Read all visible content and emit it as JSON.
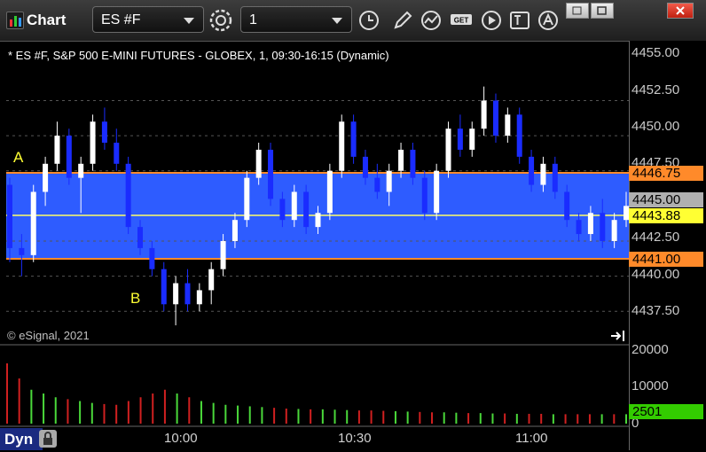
{
  "window": {
    "title": "Chart",
    "symbol": "ES #F",
    "interval": "1",
    "icons": [
      "alarm-clock-icon",
      "pencil-icon",
      "chart-line-icon",
      "get-icon",
      "play-icon",
      "text-icon",
      "alert-icon"
    ],
    "window_buttons": [
      "restore-icon",
      "maximize-icon",
      "close-icon"
    ]
  },
  "chart_title": "* ES #F, S&P 500 E-MINI FUTURES - GLOBEX, 1, 09:30-16:15 (Dynamic)",
  "copyright": "© eSignal, 2021",
  "price_axis": [
    "4455.00",
    "4452.50",
    "4450.00",
    "4447.50",
    "4445.00",
    "4442.50",
    "4440.00",
    "4437.50"
  ],
  "price_tags": {
    "upper": "4446.75",
    "last": "4445.00",
    "mid": "4443.88",
    "lower": "4441.00"
  },
  "volume_axis": [
    "20000",
    "10000",
    "0"
  ],
  "volume_tag": "2501",
  "time_axis": [
    "10:00",
    "10:30",
    "11:00"
  ],
  "annotations": {
    "a": "A",
    "b": "B"
  },
  "dyn_label": "Dyn",
  "colors": {
    "band_fill": "#2e5cff",
    "band_border": "#ff8a2a",
    "mid_line": "#ffff66",
    "up_candle": "#ffffff",
    "down_candle": "#1a2cff",
    "volume_up": "#4ad83a",
    "volume_down": "#d02020",
    "price_tag_orange": "#ff8a2a",
    "price_tag_grey": "#b0b0b0",
    "price_tag_yellow": "#ffff33",
    "volume_tag_green": "#33cc00"
  },
  "chart_data": {
    "type": "candlestick",
    "ylim": [
      4436,
      4456
    ],
    "reference_levels": {
      "upper": 4446.75,
      "mid": 4443.88,
      "lower": 4441.0
    },
    "candles_ohlc": [
      [
        4446.5,
        4447.0,
        4441.0,
        4442.0
      ],
      [
        4442.0,
        4443.0,
        4440.0,
        4441.5
      ],
      [
        4441.5,
        4446.5,
        4441.0,
        4446.0
      ],
      [
        4446.0,
        4448.5,
        4445.0,
        4448.0
      ],
      [
        4448.0,
        4451.0,
        4447.5,
        4450.0
      ],
      [
        4450.0,
        4450.5,
        4446.5,
        4447.0
      ],
      [
        4447.0,
        4448.5,
        4444.5,
        4448.0
      ],
      [
        4448.0,
        4451.5,
        4447.5,
        4451.0
      ],
      [
        4451.0,
        4452.0,
        4449.0,
        4449.5
      ],
      [
        4449.5,
        4450.5,
        4447.5,
        4448.0
      ],
      [
        4448.0,
        4448.5,
        4443.0,
        4443.5
      ],
      [
        4443.5,
        4444.0,
        4441.5,
        4442.0
      ],
      [
        4442.0,
        4442.5,
        4440.0,
        4440.5
      ],
      [
        4440.5,
        4441.0,
        4437.5,
        4438.0
      ],
      [
        4438.0,
        4440.0,
        4436.5,
        4439.5
      ],
      [
        4439.5,
        4440.5,
        4437.5,
        4438.0
      ],
      [
        4438.0,
        4439.5,
        4437.5,
        4439.0
      ],
      [
        4439.0,
        4441.0,
        4438.0,
        4440.5
      ],
      [
        4440.5,
        4443.0,
        4440.0,
        4442.5
      ],
      [
        4442.5,
        4444.5,
        4442.0,
        4444.0
      ],
      [
        4444.0,
        4447.5,
        4443.5,
        4447.0
      ],
      [
        4447.0,
        4449.5,
        4446.5,
        4449.0
      ],
      [
        4449.0,
        4449.5,
        4445.0,
        4445.5
      ],
      [
        4445.5,
        4446.0,
        4443.5,
        4444.0
      ],
      [
        4444.0,
        4446.5,
        4443.5,
        4446.0
      ],
      [
        4446.0,
        4446.5,
        4443.0,
        4443.5
      ],
      [
        4443.5,
        4445.0,
        4443.0,
        4444.5
      ],
      [
        4444.5,
        4448.0,
        4444.0,
        4447.5
      ],
      [
        4447.5,
        4451.5,
        4447.0,
        4451.0
      ],
      [
        4451.0,
        4451.5,
        4448.0,
        4448.5
      ],
      [
        4448.5,
        4449.0,
        4446.5,
        4447.0
      ],
      [
        4447.0,
        4448.0,
        4445.5,
        4446.0
      ],
      [
        4446.0,
        4448.0,
        4445.0,
        4447.5
      ],
      [
        4447.5,
        4449.5,
        4447.0,
        4449.0
      ],
      [
        4449.0,
        4449.5,
        4446.5,
        4447.0
      ],
      [
        4447.0,
        4447.5,
        4444.0,
        4444.5
      ],
      [
        4444.5,
        4448.0,
        4444.0,
        4447.5
      ],
      [
        4447.5,
        4451.0,
        4447.0,
        4450.5
      ],
      [
        4450.5,
        4451.5,
        4448.5,
        4449.0
      ],
      [
        4449.0,
        4451.0,
        4448.5,
        4450.5
      ],
      [
        4450.5,
        4453.5,
        4450.0,
        4452.5
      ],
      [
        4452.5,
        4453.0,
        4449.5,
        4450.0
      ],
      [
        4450.0,
        4452.0,
        4449.5,
        4451.5
      ],
      [
        4451.5,
        4452.0,
        4448.0,
        4448.5
      ],
      [
        4448.5,
        4449.0,
        4446.0,
        4446.5
      ],
      [
        4446.5,
        4448.5,
        4446.0,
        4448.0
      ],
      [
        4448.0,
        4448.5,
        4445.5,
        4446.0
      ],
      [
        4446.0,
        4446.5,
        4443.5,
        4444.0
      ],
      [
        4444.0,
        4444.5,
        4442.5,
        4443.0
      ],
      [
        4443.0,
        4445.0,
        4442.5,
        4444.5
      ],
      [
        4444.5,
        4445.5,
        4442.0,
        4442.5
      ],
      [
        4442.5,
        4444.5,
        4442.0,
        4444.0
      ],
      [
        4444.0,
        4446.0,
        4443.5,
        4445.0
      ]
    ],
    "volume": [
      16000,
      12000,
      9000,
      8000,
      7000,
      6500,
      6000,
      5500,
      5200,
      5000,
      6000,
      7000,
      8000,
      9000,
      8000,
      7000,
      6000,
      5500,
      5000,
      4800,
      4600,
      4400,
      4200,
      4000,
      3900,
      3800,
      3800,
      3700,
      3600,
      3500,
      3500,
      3400,
      3300,
      3200,
      3100,
      3000,
      3000,
      2900,
      2800,
      2800,
      2700,
      2700,
      2600,
      2600,
      2600,
      2500,
      2500,
      2500,
      2500,
      2500,
      2500,
      2501
    ]
  }
}
